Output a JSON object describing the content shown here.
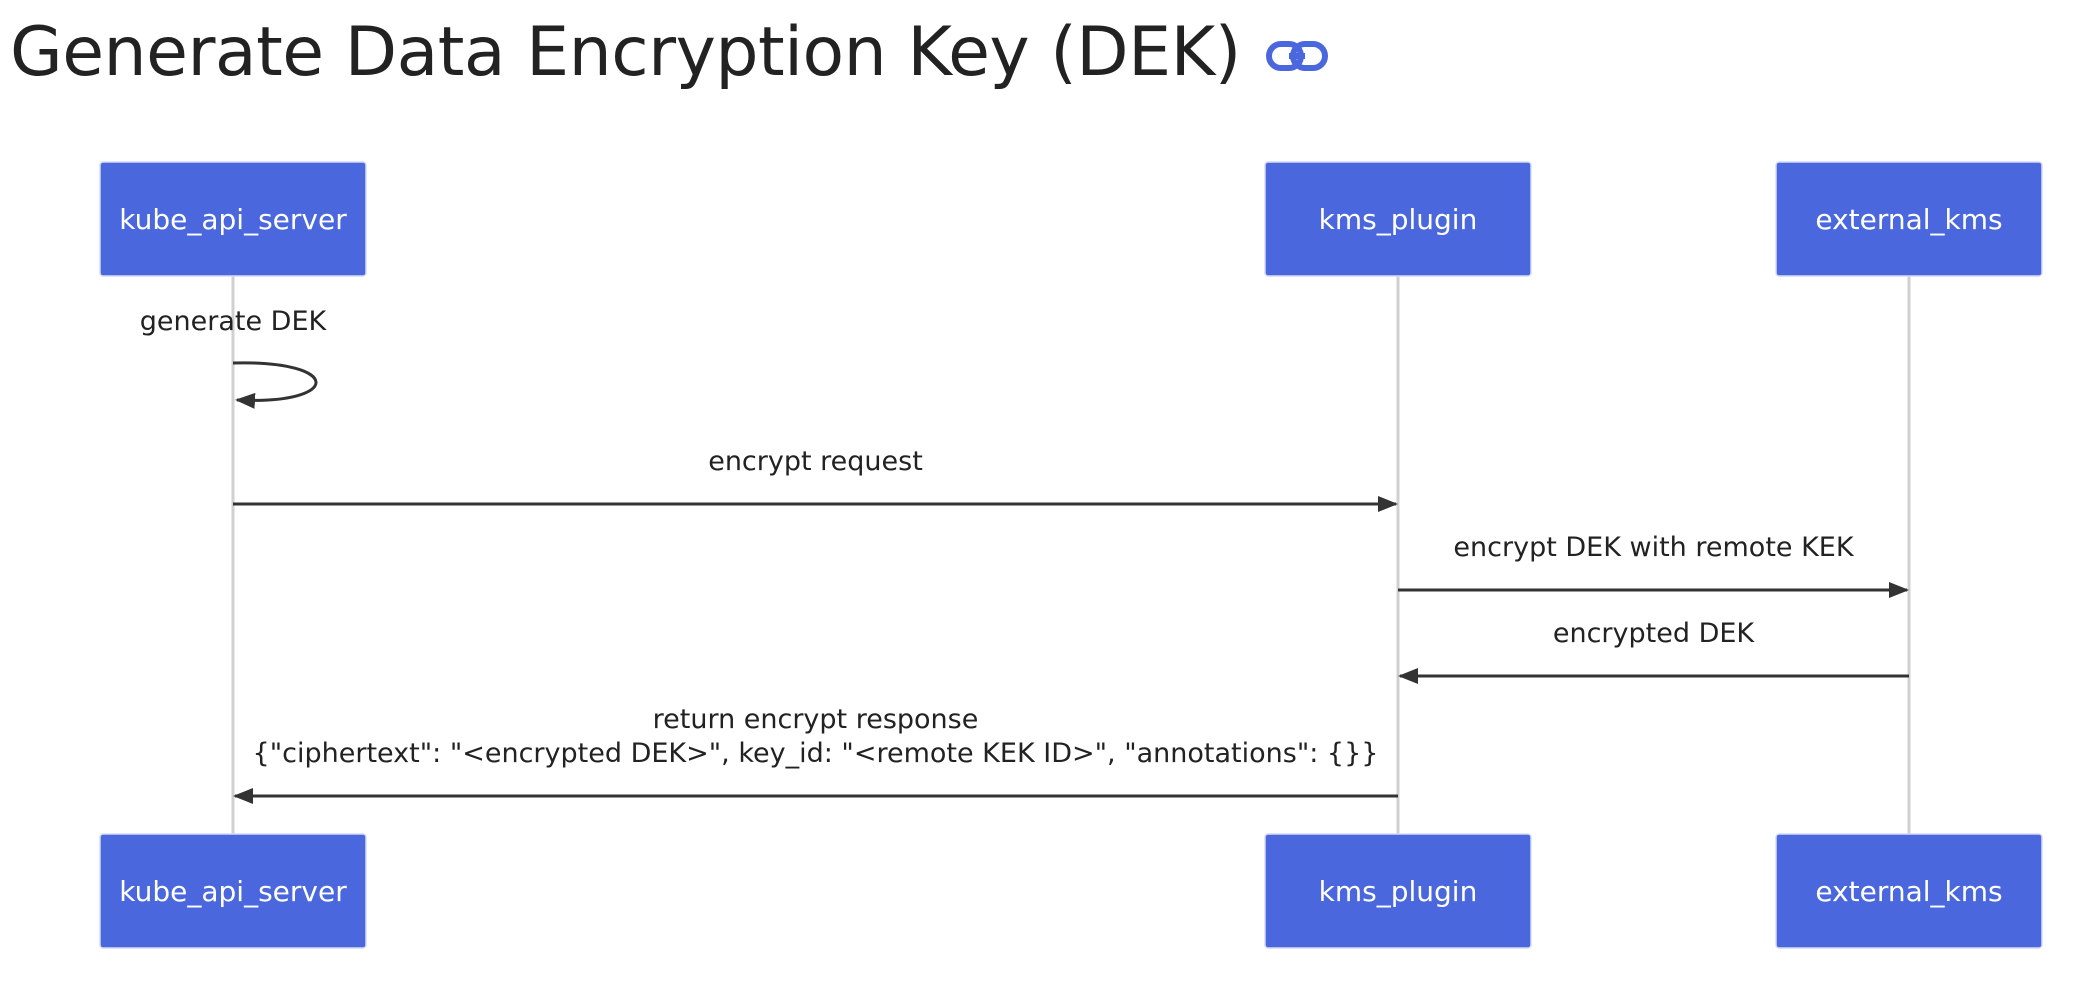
{
  "page": {
    "title": "Generate Data Encryption Key (DEK)",
    "link_icon": "link-icon"
  },
  "colors": {
    "actor_fill": "#4a67dd",
    "actor_text": "#ffffff",
    "lifeline": "#d0d0d0",
    "message": "#333333",
    "link_icon": "#4a67dd",
    "title": "#222222"
  },
  "diagram": {
    "type": "sequence",
    "actors": [
      {
        "id": "kube_api_server",
        "label": "kube_api_server"
      },
      {
        "id": "kms_plugin",
        "label": "kms_plugin"
      },
      {
        "id": "external_kms",
        "label": "external_kms"
      }
    ],
    "messages": [
      {
        "from": "kube_api_server",
        "to": "kube_api_server",
        "lines": [
          "generate DEK"
        ],
        "self": true
      },
      {
        "from": "kube_api_server",
        "to": "kms_plugin",
        "lines": [
          "encrypt request"
        ]
      },
      {
        "from": "kms_plugin",
        "to": "external_kms",
        "lines": [
          "encrypt DEK with remote KEK"
        ]
      },
      {
        "from": "external_kms",
        "to": "kms_plugin",
        "lines": [
          "encrypted DEK"
        ]
      },
      {
        "from": "kms_plugin",
        "to": "kube_api_server",
        "lines": [
          "return encrypt response",
          "{\"ciphertext\": \"<encrypted DEK>\", key_id: \"<remote KEK ID>\", \"annotations\": {}}"
        ]
      }
    ]
  }
}
